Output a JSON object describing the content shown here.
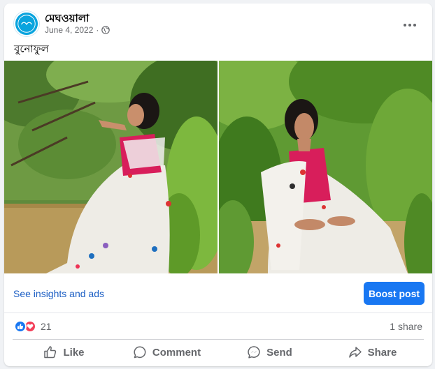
{
  "post": {
    "page_name": "মেঘওয়ালা",
    "date": "June 4, 2022",
    "separator": "·",
    "caption": "বুনোফুল"
  },
  "icons": {
    "avatar": "page-avatar-logo",
    "audience": "globe-icon",
    "more": "more-options-icon",
    "like": "thumbs-up-icon",
    "comment": "comment-bubble-icon",
    "send": "messenger-send-icon",
    "share": "share-arrow-icon"
  },
  "photos": [
    {
      "description_name": "photo-1"
    },
    {
      "description_name": "photo-2"
    }
  ],
  "insights": {
    "link_label": "See insights and ads",
    "boost_label": "Boost post"
  },
  "engagement": {
    "reaction_count": "21",
    "shares": "1 share"
  },
  "actions": {
    "like": "Like",
    "comment": "Comment",
    "send": "Send",
    "share": "Share"
  },
  "colors": {
    "accent": "#1877f2",
    "link": "#1b5ec4",
    "love": "#f33e58",
    "muted_text": "#65676b"
  }
}
